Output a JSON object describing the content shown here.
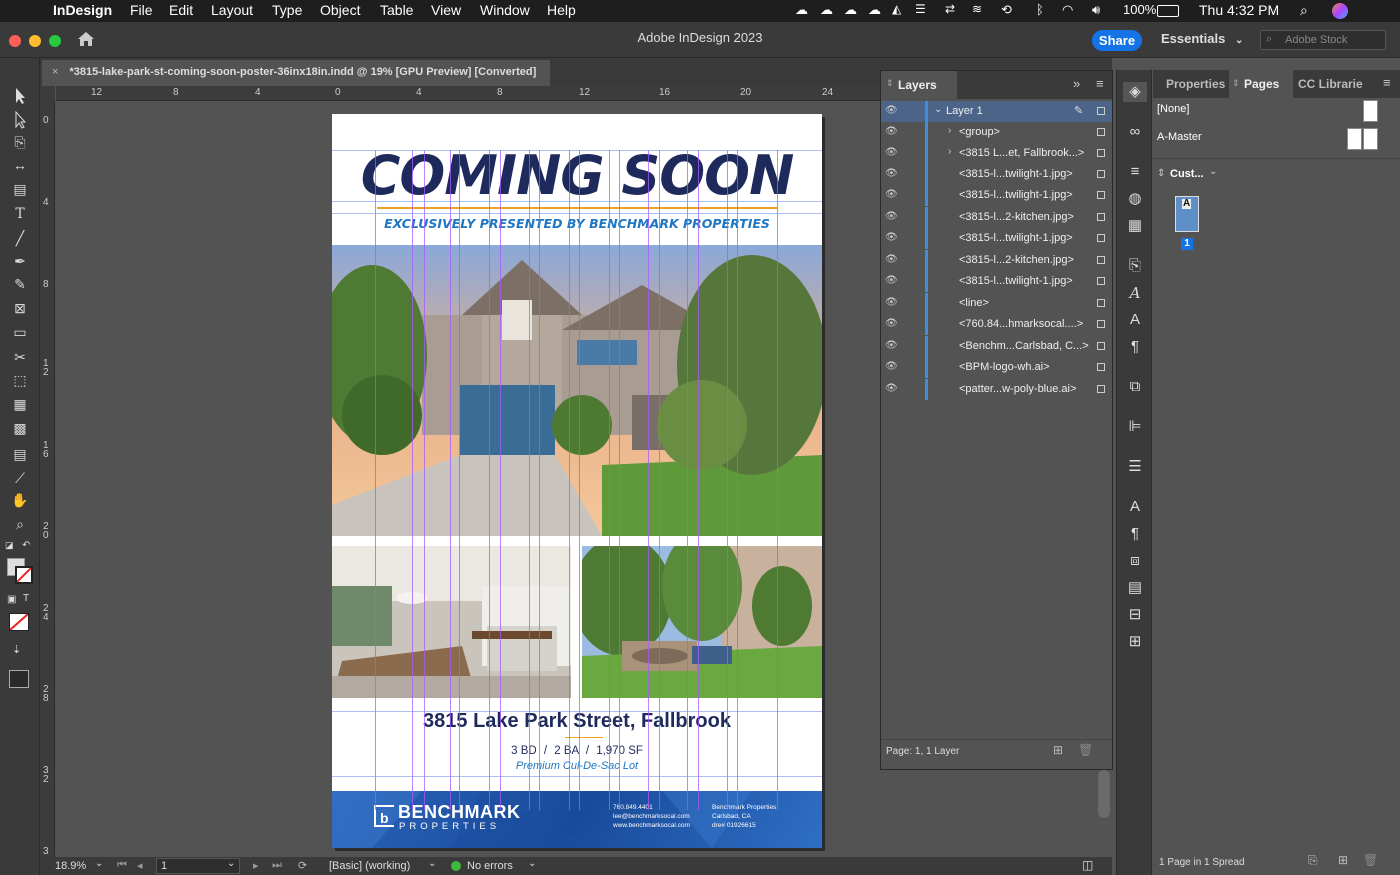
{
  "menubar": {
    "app_name": "InDesign",
    "items": [
      "File",
      "Edit",
      "Layout",
      "Type",
      "Object",
      "Table",
      "View",
      "Window",
      "Help"
    ],
    "battery": "100%",
    "clock": "Thu 4:32 PM"
  },
  "apptitle": {
    "title": "Adobe InDesign 2023",
    "share_label": "Share",
    "workspace_label": "Essentials",
    "search_placeholder": "Adobe Stock"
  },
  "document": {
    "tab_title": "*3815-lake-park-st-coming-soon-poster-36inx18in.indd @ 19% [GPU Preview] [Converted]"
  },
  "rulers": {
    "horizontal": [
      "12",
      "8",
      "4",
      "0",
      "4",
      "8",
      "12",
      "16",
      "20",
      "24"
    ],
    "vertical": [
      "0",
      "4",
      "8",
      "1\n2",
      "1\n6",
      "2\n0",
      "2\n4",
      "2\n8",
      "3\n2",
      "3"
    ]
  },
  "poster": {
    "headline": "COMING SOON",
    "subhead": "EXCLUSIVELY PRESENTED BY BENCHMARK PROPERTIES",
    "address": "3815 Lake Park Street, Fallbrook",
    "specs_bd": "3 BD",
    "specs_ba": "2 BA",
    "specs_sf": "1,970 SF",
    "sep": "/",
    "tagline": "Premium Cul-De-Sac Lot",
    "logo_main": "BENCHMARK",
    "logo_sub": "PROPERTIES",
    "contact_phone": "760.849.4401",
    "contact_email": "lee@benchmarksocal.com",
    "contact_web": "www.benchmarksocal.com",
    "company_name": "Benchmark Properties",
    "company_city": "Carlsbad, CA",
    "company_dre": "dre# 01926615",
    "colors": {
      "navy": "#1f2a5c",
      "blue": "#1f76c2",
      "orange": "#f0a020"
    }
  },
  "statusbar": {
    "zoom": "18.9%",
    "page": "1",
    "style": "[Basic] (working)",
    "preflight": "No errors"
  },
  "layers": {
    "title": "Layers",
    "layer_name": "Layer 1",
    "items": [
      "<group>",
      "<3815 L...et, Fallbrook...>",
      "<3815-l...twilight-1.jpg>",
      "<3815-l...twilight-1.jpg>",
      "<3815-l...2-kitchen.jpg>",
      "<3815-l...twilight-1.jpg>",
      "<3815-l...2-kitchen.jpg>",
      "<3815-l...twilight-1.jpg>",
      "<line>",
      "<760.84...hmarksocal....>",
      "<Benchm...Carlsbad, C...>",
      "<BPM-logo-wh.ai>",
      "<patter...w-poly-blue.ai>"
    ],
    "footer": "Page: 1, 1 Layer"
  },
  "pages_panel": {
    "tabs": [
      "Properties",
      "Pages",
      "CC Librarie"
    ],
    "none_label": "[None]",
    "master_label": "A-Master",
    "size_label": "Cust...",
    "page_number": "1",
    "master_letter": "A",
    "footer": "1 Page in 1 Spread"
  }
}
